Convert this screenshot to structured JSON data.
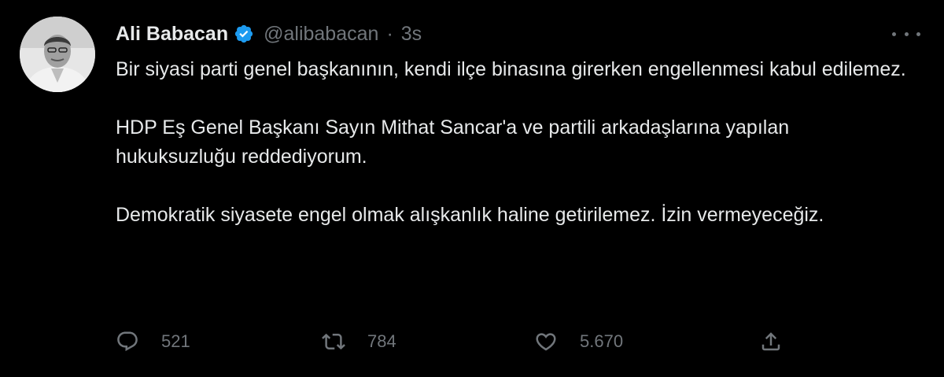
{
  "author": {
    "display_name": "Ali Babacan",
    "verified_icon": "verified-badge-icon",
    "handle": "@alibabacan",
    "separator": "·",
    "time": "3s"
  },
  "tweet": {
    "paragraphs": [
      "Bir siyasi parti genel başkanının, kendi ilçe binasına girerken engellenmesi kabul edilemez.",
      "HDP Eş Genel Başkanı Sayın Mithat Sancar'a ve partili arkadaşlarına yapılan hukuksuzluğu reddediyorum.",
      "Demokratik siyasete engel olmak alışkanlık haline getirilemez. İzin vermeyeceğiz."
    ]
  },
  "actions": {
    "reply": {
      "icon": "reply-icon",
      "count": "521"
    },
    "retweet": {
      "icon": "retweet-icon",
      "count": "784"
    },
    "like": {
      "icon": "heart-icon",
      "count": "5.670"
    },
    "share": {
      "icon": "share-icon"
    }
  },
  "colors": {
    "background": "#000000",
    "text_primary": "#e7e9ea",
    "text_secondary": "#71767b",
    "verified": "#1d9bf0"
  }
}
